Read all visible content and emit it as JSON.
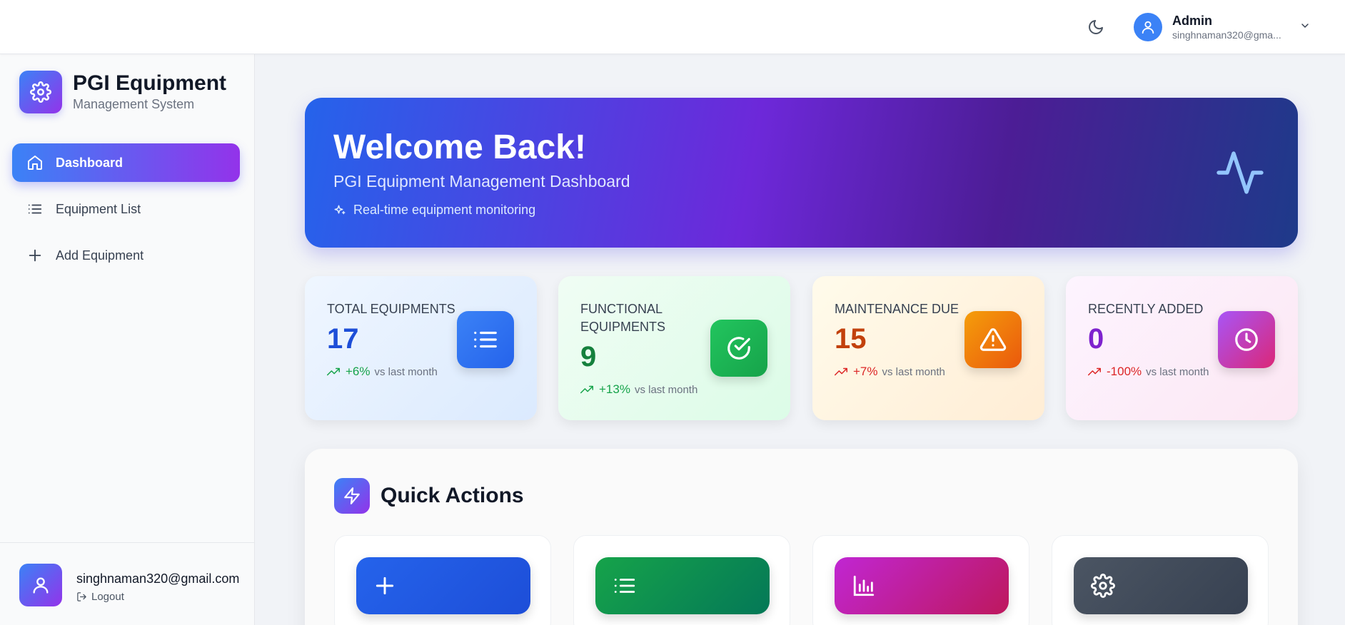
{
  "header": {
    "user_name": "Admin",
    "user_email": "singhnaman320@gma..."
  },
  "sidebar": {
    "brand_title": "PGI Equipment",
    "brand_subtitle": "Management System",
    "items": [
      {
        "label": "Dashboard",
        "icon": "home-icon",
        "active": true
      },
      {
        "label": "Equipment List",
        "icon": "list-icon",
        "active": false
      },
      {
        "label": "Add Equipment",
        "icon": "plus-icon",
        "active": false
      }
    ],
    "footer_email": "singhnaman320@gmail.com",
    "logout_label": "Logout"
  },
  "hero": {
    "title": "Welcome Back!",
    "subtitle": "PGI Equipment Management Dashboard",
    "tag": "Real-time equipment monitoring"
  },
  "stats": [
    {
      "label": "TOTAL EQUIPMENTS",
      "value": "17",
      "change": "+6%",
      "suffix": "vs last month",
      "color": "#1d4ed8",
      "trend_color": "#16a34a",
      "icon": "list-icon"
    },
    {
      "label": "FUNCTIONAL EQUIPMENTS",
      "value": "9",
      "change": "+13%",
      "suffix": "vs last month",
      "color": "#15803d",
      "trend_color": "#16a34a",
      "icon": "check-circle-icon"
    },
    {
      "label": "MAINTENANCE DUE",
      "value": "15",
      "change": "+7%",
      "suffix": "vs last month",
      "color": "#c2410c",
      "trend_color": "#dc2626",
      "icon": "warning-icon"
    },
    {
      "label": "RECENTLY ADDED",
      "value": "0",
      "change": "-100%",
      "suffix": "vs last month",
      "color": "#7e22ce",
      "trend_color": "#dc2626",
      "icon": "clock-icon"
    }
  ],
  "quick_actions": {
    "title": "Quick Actions",
    "actions": [
      {
        "icon": "plus-icon",
        "color": "#2563eb"
      },
      {
        "icon": "list-icon",
        "color": "#16a34a"
      },
      {
        "icon": "bar-chart-icon",
        "color": "#c026d3"
      },
      {
        "icon": "gear-icon",
        "color": "#374151"
      }
    ]
  }
}
